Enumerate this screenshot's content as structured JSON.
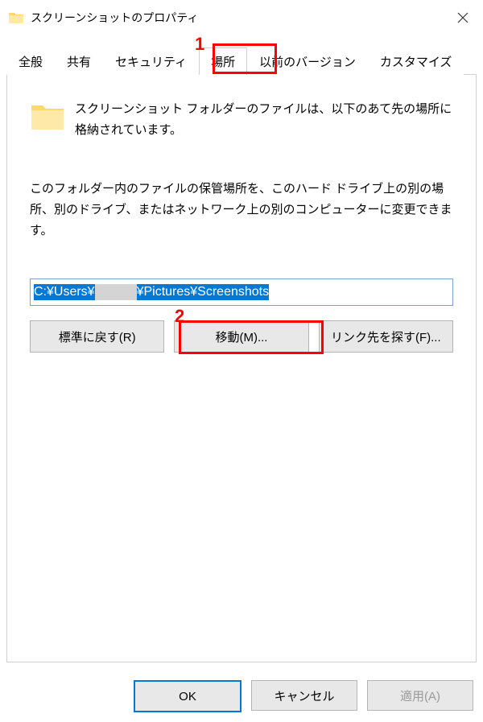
{
  "window": {
    "title": "スクリーンショットのプロパティ"
  },
  "tabs": {
    "t1": "全般",
    "t2": "共有",
    "t3": "セキュリティ",
    "t4": "場所",
    "t5": "以前のバージョン",
    "t6": "カスタマイズ"
  },
  "body": {
    "desc1": "スクリーンショット フォルダーのファイルは、以下のあて先の場所に格納されています。",
    "desc2": "このフォルダー内のファイルの保管場所を、このハード ドライブ上の別の場所、別のドライブ、またはネットワーク上の別のコンピューターに変更できます。",
    "path_a": "C:¥Users¥",
    "path_b": "¥Pictures¥Screenshots"
  },
  "buttons": {
    "restore": "標準に戻す(R)",
    "move": "移動(M)...",
    "find": "リンク先を探す(F)...",
    "ok": "OK",
    "cancel": "キャンセル",
    "apply": "適用(A)"
  },
  "annotations": {
    "n1": "1",
    "n2": "2"
  }
}
